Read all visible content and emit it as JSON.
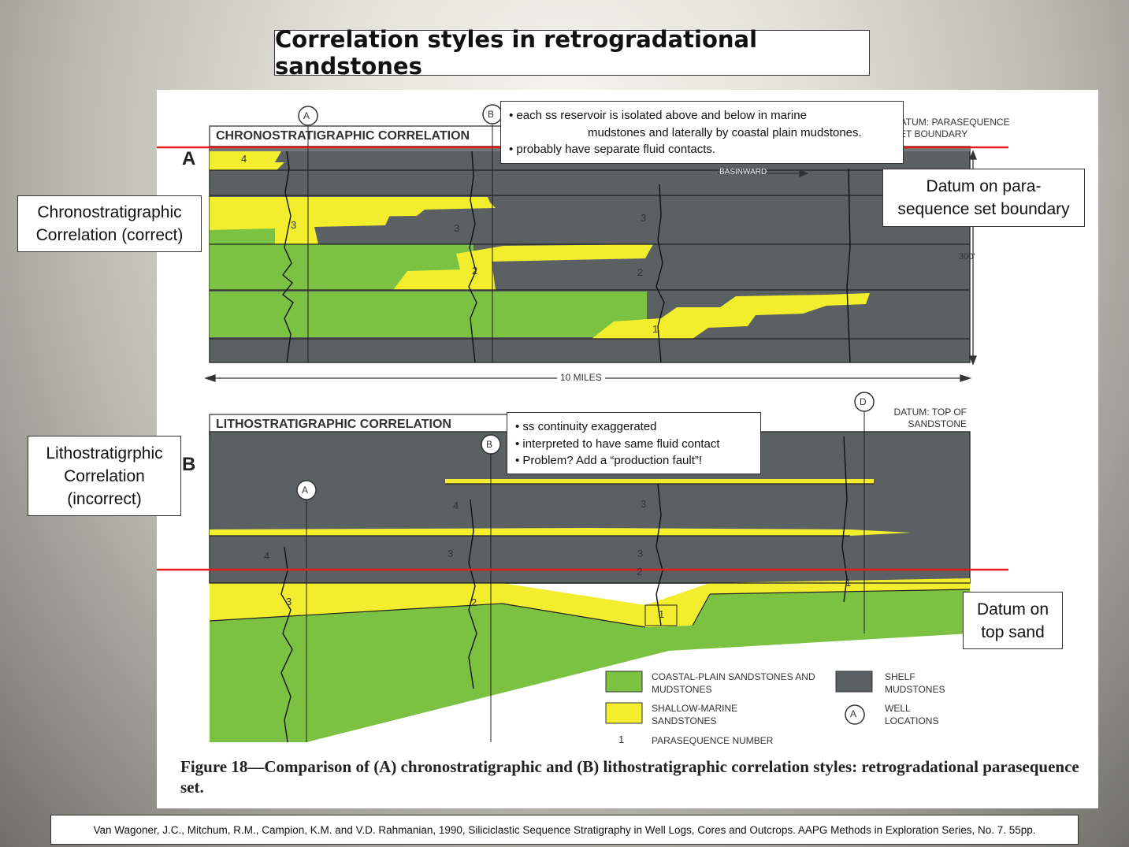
{
  "title": "Correlation styles in retrogradational sandstones",
  "colors": {
    "coastal_plain": "#7cc242",
    "shallow_marine": "#f2ee2e",
    "shelf": "#5b6063",
    "datum_line": "#e31b1b"
  },
  "panel_a": {
    "letter": "A",
    "heading": "CHRONOSTRATIGRAPHIC CORRELATION",
    "datum_note": "DATUM: PARASEQUENCE SET BOUNDARY",
    "basinward": "BASINWARD",
    "scale_vertical": "300'",
    "scale_horizontal": "10 MILES",
    "wells": [
      "A",
      "B"
    ],
    "parasequence_numbers": [
      "4",
      "3",
      "3",
      "3",
      "2",
      "2",
      "1"
    ]
  },
  "panel_b": {
    "letter": "B",
    "heading": "LITHOSTRATIGRAPHIC CORRELATION",
    "datum_note": "DATUM: TOP OF SANDSTONE",
    "wells": [
      "A",
      "B",
      "D"
    ],
    "parasequence_numbers": [
      "4",
      "3",
      "4",
      "3",
      "3",
      "2",
      "3",
      "2",
      "1",
      "1"
    ]
  },
  "legend": {
    "coastal_plain": "COASTAL-PLAIN SANDSTONES AND MUDSTONES",
    "shallow_marine": "SHALLOW-MARINE SANDSTONES",
    "shelf": "SHELF MUDSTONES",
    "wells": "WELL LOCATIONS",
    "well_symbol": "A",
    "parasequence_number_symbol": "1",
    "parasequence_number": "PARASEQUENCE NUMBER"
  },
  "caption": "Figure 18—Comparison of (A) chronostratigraphic and (B) lithostratigraphic correlation styles: retrogradational parasequence set.",
  "callouts": {
    "chrono": "Chronostratigraphic Correlation (correct)",
    "litho": "Lithostratigrphic Correlation (incorrect)",
    "datum_para": "Datum on para-sequence set boundary",
    "datum_top": "Datum on top sand",
    "note_a": [
      "• each ss reservoir is isolated above and below in marine",
      "mudstones and laterally by coastal plain mudstones.",
      "• probably have separate fluid contacts."
    ],
    "note_b": [
      "• ss continuity exaggerated",
      "• interpreted to have same fluid contact",
      "• Problem? Add a “production fault”!"
    ]
  },
  "reference": "Van Wagoner, J.C., Mitchum, R.M., Campion, K.M. and V.D. Rahmanian, 1990, Siliciclastic Sequence Stratigraphy in Well Logs, Cores and Outcrops.  AAPG Methods in Exploration Series, No. 7.  55pp."
}
